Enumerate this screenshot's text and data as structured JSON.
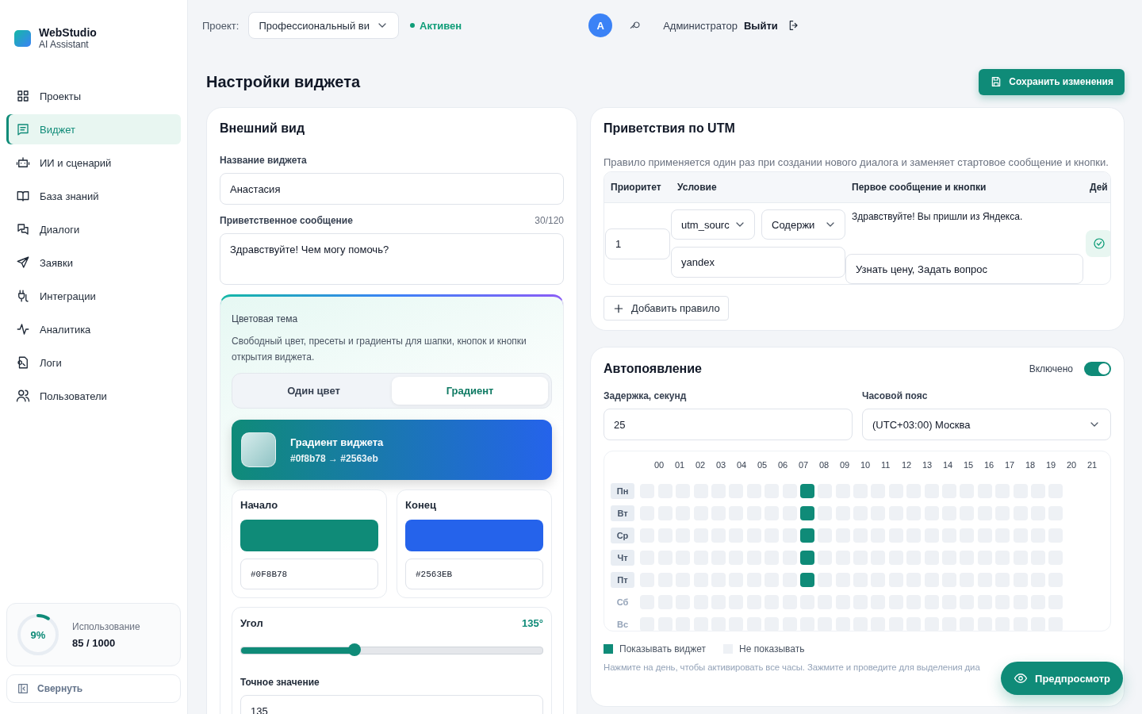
{
  "brand": {
    "name": "WebStudio",
    "subtitle": "AI Assistant"
  },
  "sidebar": {
    "items": [
      {
        "label": "Проекты",
        "selected": false
      },
      {
        "label": "Виджет",
        "selected": true
      },
      {
        "label": "ИИ и сценарий",
        "selected": false
      },
      {
        "label": "База знаний",
        "selected": false
      },
      {
        "label": "Диалоги",
        "selected": false
      },
      {
        "label": "Заявки",
        "selected": false
      },
      {
        "label": "Интеграции",
        "selected": false
      },
      {
        "label": "Аналитика",
        "selected": false
      },
      {
        "label": "Логи",
        "selected": false
      },
      {
        "label": "Пользователи",
        "selected": false
      }
    ],
    "usage": {
      "level": 0.09,
      "percent": "9%",
      "label": "Использование",
      "value": "85 / 1000"
    },
    "collapse": "Свернуть"
  },
  "topbar": {
    "project_label": "Проект:",
    "project": "Профессиональный ви",
    "status": "Активен",
    "avatar": "A",
    "user": "Администратор",
    "logout": "Выйти"
  },
  "page": {
    "title": "Настройки виджета",
    "save_button": "Сохранить изменения"
  },
  "appearance": {
    "title": "Внешний вид",
    "name_label": "Название виджета",
    "name_value": "Анастасия",
    "greeting_label": "Приветственное сообщение",
    "greeting_counter": "30/120",
    "greeting_value": "Здравствуйте! Чем могу помочь?",
    "theme": {
      "title": "Цветовая тема",
      "description": "Свободный цвет, пресеты и градиенты для шапки, кнопок и кнопки открытия виджета.",
      "tabs": [
        {
          "label": "Один цвет",
          "selected": false
        },
        {
          "label": "Градиент",
          "selected": true
        }
      ],
      "preview_title": "Градиент виджета",
      "preview_value": "#0f8b78 → #2563eb",
      "stops": [
        {
          "label": "Начало",
          "color": "#0f8b78",
          "value": "#0F8B78"
        },
        {
          "label": "Конец",
          "color": "#2563eb",
          "value": "#2563EB"
        }
      ],
      "angle_label": "Угол",
      "angle_value": "135°",
      "level": 0.375,
      "exact_label": "Точное значение",
      "exact_value": "135"
    }
  },
  "utm": {
    "title": "Приветствия по UTM",
    "description": "Правило применяется один раз при создании нового диалога и заменяет стартовое сообщение и кнопки.",
    "columns": [
      "Приоритет",
      "Условие",
      "Первое сообщение и кнопки",
      "Дей"
    ],
    "rows": [
      {
        "priority": "1",
        "param": "utm_sourc",
        "operator": "Содержи",
        "value": "yandex",
        "message": "Здравствуйте! Вы пришли из Яндекса.",
        "buttons": "Узнать цену, Задать вопрос"
      }
    ],
    "add_button": "Добавить правило"
  },
  "autoshow": {
    "title": "Автопоявление",
    "enabled_label": "Включено",
    "enabled": true,
    "delay_label": "Задержка, секунд",
    "delay_value": "25",
    "timezone_label": "Часовой пояс",
    "timezone_value": "(UTC+03:00) Москва",
    "hours": [
      "00",
      "01",
      "02",
      "03",
      "04",
      "05",
      "06",
      "07",
      "08",
      "09",
      "10",
      "11",
      "12",
      "13",
      "14",
      "15",
      "16",
      "17",
      "18",
      "19",
      "20",
      "21"
    ],
    "days": [
      {
        "label": "Пн",
        "active": true,
        "cells": [
          false,
          false,
          false,
          false,
          false,
          false,
          false,
          false,
          false,
          true,
          false,
          false,
          false,
          false,
          false,
          false,
          false,
          false,
          false,
          false,
          false,
          false,
          false,
          false
        ]
      },
      {
        "label": "Вт",
        "active": true,
        "cells": [
          false,
          false,
          false,
          false,
          false,
          false,
          false,
          false,
          false,
          true,
          false,
          false,
          false,
          false,
          false,
          false,
          false,
          false,
          false,
          false,
          false,
          false,
          false,
          false
        ]
      },
      {
        "label": "Ср",
        "active": true,
        "cells": [
          false,
          false,
          false,
          false,
          false,
          false,
          false,
          false,
          false,
          true,
          false,
          false,
          false,
          false,
          false,
          false,
          false,
          false,
          false,
          false,
          false,
          false,
          false,
          false
        ]
      },
      {
        "label": "Чт",
        "active": true,
        "cells": [
          false,
          false,
          false,
          false,
          false,
          false,
          false,
          false,
          false,
          true,
          false,
          false,
          false,
          false,
          false,
          false,
          false,
          false,
          false,
          false,
          false,
          false,
          false,
          false
        ]
      },
      {
        "label": "Пт",
        "active": true,
        "cells": [
          false,
          false,
          false,
          false,
          false,
          false,
          false,
          false,
          false,
          true,
          false,
          false,
          false,
          false,
          false,
          false,
          false,
          false,
          false,
          false,
          false,
          false,
          false,
          false
        ]
      },
      {
        "label": "Сб",
        "active": false,
        "cells": [
          false,
          false,
          false,
          false,
          false,
          false,
          false,
          false,
          false,
          false,
          false,
          false,
          false,
          false,
          false,
          false,
          false,
          false,
          false,
          false,
          false,
          false,
          false,
          false
        ]
      },
      {
        "label": "Вс",
        "active": false,
        "cells": [
          false,
          false,
          false,
          false,
          false,
          false,
          false,
          false,
          false,
          false,
          false,
          false,
          false,
          false,
          false,
          false,
          false,
          false,
          false,
          false,
          false,
          false,
          false,
          false
        ]
      }
    ],
    "legend_on": "Показывать виджет",
    "legend_off": "Не показывать",
    "hint": "Нажмите на день, чтобы активировать все часы. Зажмите и проведите для выделения диа"
  },
  "preview_button": "Предпросмотр"
}
